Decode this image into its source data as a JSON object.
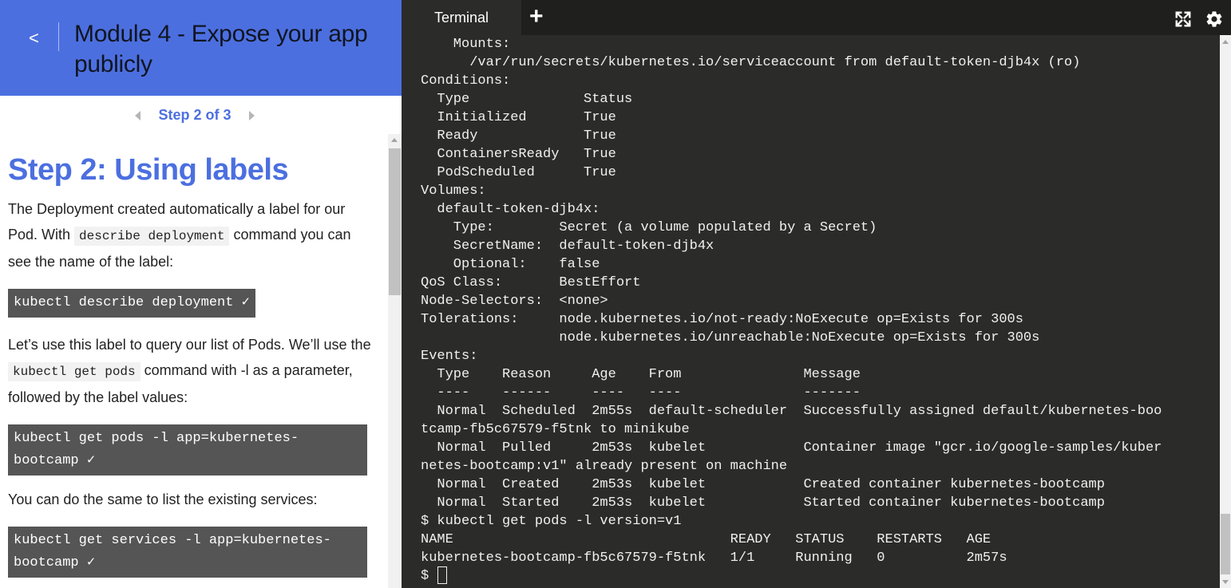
{
  "colors": {
    "accent": "#4c6fe0",
    "terminal_bg": "#2b2b29",
    "command_bg": "#555555"
  },
  "header": {
    "back_label": "<",
    "title": "Module 4 - Expose your app publicly"
  },
  "step_nav": {
    "label": "Step 2 of 3",
    "prev_icon": "chevron-left-icon",
    "next_icon": "chevron-right-icon"
  },
  "content": {
    "title": "Step 2: Using labels",
    "p1_a": "The Deployment created automatically a label for our Pod. With ",
    "p1_code": "describe deployment",
    "p1_b": " command you can see the name of the label:",
    "cmd1": "kubectl describe deployment ✓",
    "p2_a": "Let’s use this label to query our list of Pods. We’ll use the ",
    "p2_code": "kubectl get pods",
    "p2_b": " command with -l as a parameter, followed by the label values:",
    "cmd2": "kubectl get pods -l app=kubernetes-bootcamp ✓",
    "p3": "You can do the same to list the existing services:",
    "cmd3": "kubectl get services -l app=kubernetes-bootcamp ✓"
  },
  "terminal": {
    "tab_label": "Terminal",
    "add_tab_label": "+",
    "icons": [
      "fullscreen-icon",
      "settings-icon"
    ],
    "output": "    Mounts:\n      /var/run/secrets/kubernetes.io/serviceaccount from default-token-djb4x (ro)\nConditions:\n  Type              Status\n  Initialized       True\n  Ready             True\n  ContainersReady   True\n  PodScheduled      True\nVolumes:\n  default-token-djb4x:\n    Type:        Secret (a volume populated by a Secret)\n    SecretName:  default-token-djb4x\n    Optional:    false\nQoS Class:       BestEffort\nNode-Selectors:  <none>\nTolerations:     node.kubernetes.io/not-ready:NoExecute op=Exists for 300s\n                 node.kubernetes.io/unreachable:NoExecute op=Exists for 300s\nEvents:\n  Type    Reason     Age    From               Message\n  ----    ------     ----   ----               -------\n  Normal  Scheduled  2m55s  default-scheduler  Successfully assigned default/kubernetes-boo\ntcamp-fb5c67579-f5tnk to minikube\n  Normal  Pulled     2m53s  kubelet            Container image \"gcr.io/google-samples/kuber\nnetes-bootcamp:v1\" already present on machine\n  Normal  Created    2m53s  kubelet            Created container kubernetes-bootcamp\n  Normal  Started    2m53s  kubelet            Started container kubernetes-bootcamp\n$ kubectl get pods -l version=v1\nNAME                                  READY   STATUS    RESTARTS   AGE\nkubernetes-bootcamp-fb5c67579-f5tnk   1/1     Running   0          2m57s",
    "prompt": "$ "
  }
}
